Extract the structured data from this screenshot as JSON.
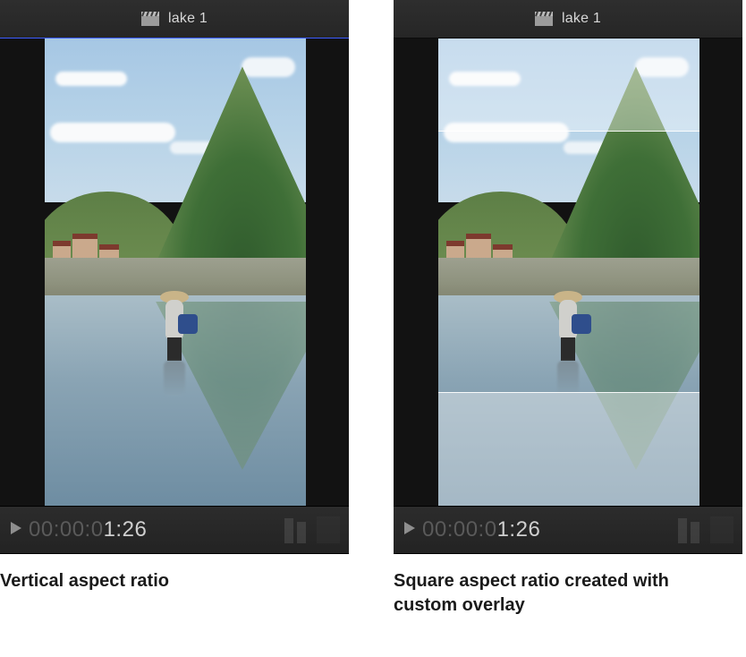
{
  "viewers": {
    "left": {
      "clip_title": "lake 1",
      "timecode_prefix": "00:00:0",
      "timecode_live": "1:26",
      "caption": "Vertical aspect ratio"
    },
    "right": {
      "clip_title": "lake 1",
      "timecode_prefix": "00:00:0",
      "timecode_live": "1:26",
      "caption": "Square aspect ratio created with custom overlay",
      "overlay": "square-custom"
    }
  },
  "icons": {
    "clapper": "clapper-icon",
    "play": "play-icon"
  },
  "colors": {
    "panel_bg": "#1c1c1c",
    "active_rule": "#3a5bff",
    "text_dim": "#5a5a5a",
    "text_live": "#cfcfcf"
  }
}
